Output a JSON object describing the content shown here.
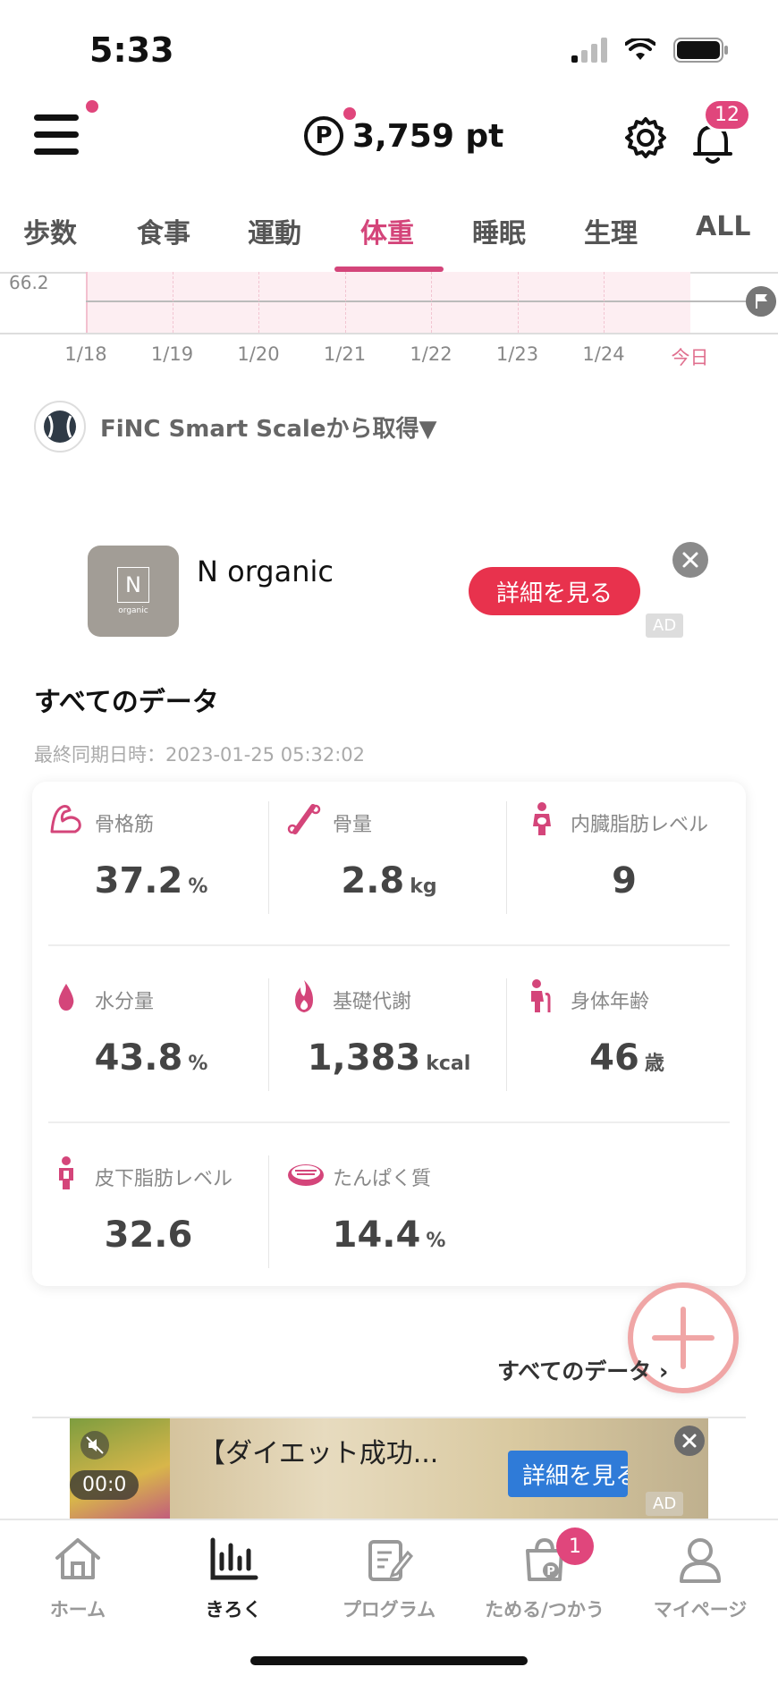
{
  "status_bar": {
    "time": "5:33"
  },
  "header": {
    "points_icon": "P",
    "points": "3,759 pt",
    "notification_count": "12"
  },
  "tabs": [
    {
      "label": "歩数"
    },
    {
      "label": "食事"
    },
    {
      "label": "運動"
    },
    {
      "label": "体重",
      "active": true
    },
    {
      "label": "睡眠"
    },
    {
      "label": "生理"
    },
    {
      "label": "ALL"
    }
  ],
  "chart_data": {
    "type": "line",
    "y_label_visible": "66.2",
    "x": [
      "1/18",
      "1/19",
      "1/20",
      "1/21",
      "1/22",
      "1/23",
      "1/24",
      "今日"
    ]
  },
  "source": {
    "label": "FiNC Smart Scaleから取得▼"
  },
  "ad_top": {
    "logo_letter": "N",
    "logo_small": "organic",
    "title": "N organic",
    "button": "詳細を見る",
    "ad_tag": "AD"
  },
  "all_data": {
    "title": "すべてのデータ",
    "sync": "最終同期日時：2023-01-25 05:32:02",
    "items": [
      {
        "label": "骨格筋",
        "value": "37.2",
        "unit": "%"
      },
      {
        "label": "骨量",
        "value": "2.8",
        "unit": "kg"
      },
      {
        "label": "内臓脂肪レベル",
        "value": "9",
        "unit": ""
      },
      {
        "label": "水分量",
        "value": "43.8",
        "unit": "%"
      },
      {
        "label": "基礎代謝",
        "value": "1,383",
        "unit": "kcal"
      },
      {
        "label": "身体年齢",
        "value": "46",
        "unit": "歳"
      },
      {
        "label": "皮下脂肪レベル",
        "value": "32.6",
        "unit": ""
      },
      {
        "label": "たんぱく質",
        "value": "14.4",
        "unit": "%"
      }
    ],
    "see_all": "すべてのデータ"
  },
  "ad_bottom": {
    "timer": "00:0",
    "title": "【ダイエット成功...",
    "button": "詳細を見る",
    "ad_tag": "AD"
  },
  "bottom_nav": [
    {
      "label": "ホーム"
    },
    {
      "label": "きろく",
      "active": true
    },
    {
      "label": "プログラム"
    },
    {
      "label": "ためる/つかう"
    },
    {
      "label": "マイページ"
    }
  ],
  "nav_badge": "1",
  "colors": {
    "accent": "#d4457a",
    "badge": "#e0467c",
    "ad_button": "#e8324d",
    "fab_border": "#f0a6a6"
  }
}
